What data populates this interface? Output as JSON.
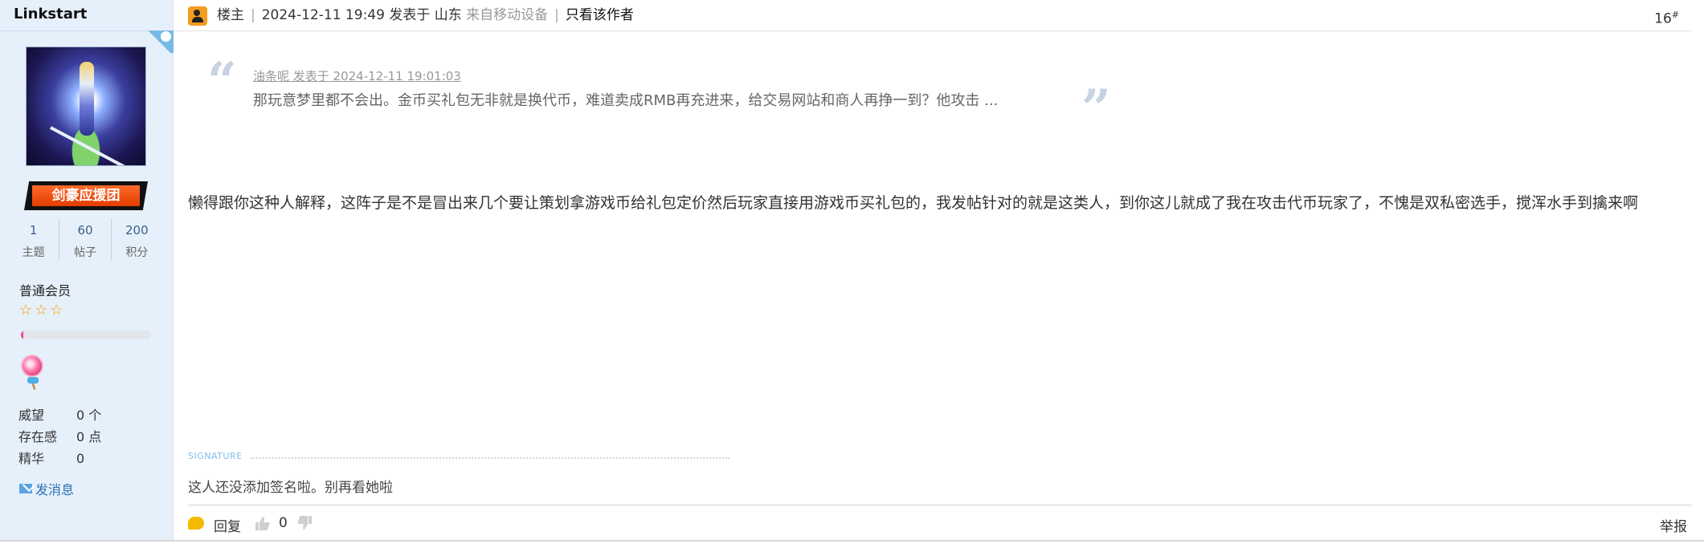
{
  "user": {
    "username": "Linkstart",
    "group_badge": "剑豪应援团",
    "stats": [
      {
        "value": "1",
        "label": "主题"
      },
      {
        "value": "60",
        "label": "帖子"
      },
      {
        "value": "200",
        "label": "积分"
      }
    ],
    "level_name": "普通会员",
    "star_count": 3,
    "exp_progress": 0.02,
    "profile": [
      {
        "key": "威望",
        "value": "0 个"
      },
      {
        "key": "存在感",
        "value": "0 点"
      },
      {
        "key": "精华",
        "value": "0"
      }
    ],
    "send_message_label": "发消息"
  },
  "post": {
    "role": "楼主",
    "datetime": "2024-12-11 19:49",
    "posted_in": "发表于 山东",
    "device": "来自移动设备",
    "only_author": "只看该作者",
    "floor": "16",
    "floor_mark": "#",
    "quote": {
      "meta": "油条呢 发表于 2024-12-11 19:01:03",
      "text": "那玩意梦里都不会出。金币买礼包无非就是换代币，难道卖成RMB再充进来，给交易网站和商人再挣一到？他攻击 ...",
      "open_mark": "“",
      "close_mark": "”"
    },
    "body": "懒得跟你这种人解释，这阵子是不是冒出来几个要让策划拿游戏币给礼包定价然后玩家直接用游戏币买礼包的，我发帖针对的就是这类人，到你这儿就成了我在攻击代币玩家了，不愧是双私密选手，搅浑水手到擒来啊",
    "signature_label": "SIGNATURE",
    "signature": "这人还没添加签名啦。别再看她啦"
  },
  "footer": {
    "reply_label": "回复",
    "like_count": "0",
    "report_label": "举报"
  },
  "colors": {
    "sidebar_bg": "#e6f0fb",
    "link_blue": "#2b6fb6",
    "badge_orange": "#e23d00",
    "star_gold": "#f2b21a",
    "exp_pink": "#f24a8a",
    "author_icon": "#f39c1f"
  },
  "icons": {
    "author": "author-icon",
    "mail": "mail-icon",
    "reply": "reply-icon",
    "like": "thumb-up-icon",
    "dislike": "thumb-down-icon",
    "medal": "lollipop-medal-icon"
  }
}
